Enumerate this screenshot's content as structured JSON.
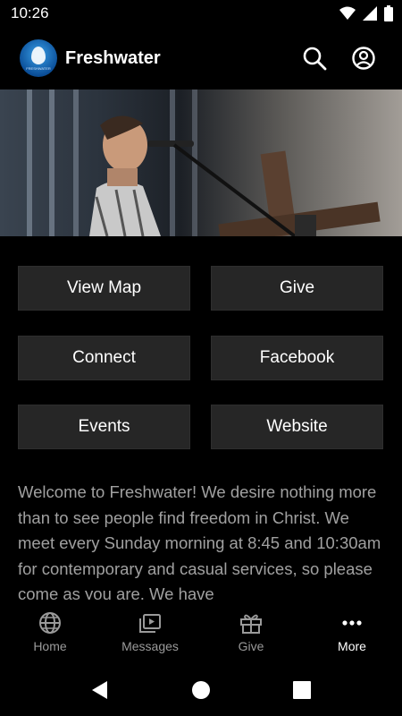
{
  "status": {
    "time": "10:26"
  },
  "header": {
    "title": "Freshwater",
    "logo_tagline": "FRESHWATER"
  },
  "buttons": [
    {
      "label": "View Map"
    },
    {
      "label": "Give"
    },
    {
      "label": "Connect"
    },
    {
      "label": "Facebook"
    },
    {
      "label": "Events"
    },
    {
      "label": "Website"
    }
  ],
  "welcome_text": "Welcome to Freshwater! We desire nothing more than to see people find freedom in Christ. We meet every Sunday morning at 8:45 and 10:30am for contemporary and casual services, so please come as you are. We have",
  "nav": [
    {
      "label": "Home",
      "icon": "globe-icon"
    },
    {
      "label": "Messages",
      "icon": "messages-icon"
    },
    {
      "label": "Give",
      "icon": "gift-icon"
    },
    {
      "label": "More",
      "icon": "more-icon",
      "active": true
    }
  ],
  "colors": {
    "background": "#000000",
    "tile": "#262626",
    "body_text": "#a0a0a0",
    "nav_inactive": "#9a9a9a"
  }
}
